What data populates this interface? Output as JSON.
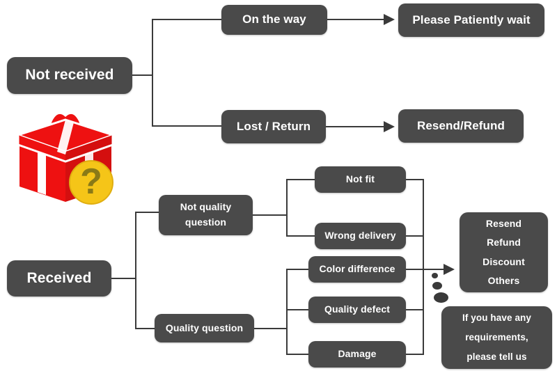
{
  "diagram": {
    "title": "Order issue resolution flowchart",
    "colors": {
      "node_fill": "#4a4a4a",
      "node_text": "#ffffff",
      "connector": "#3a3a3a",
      "background": "#ffffff",
      "gift_red": "#ee1111",
      "gift_badge": "#f5c518",
      "gift_question": "#8a7a17"
    },
    "icons": {
      "gift_box": "gift-box-icon",
      "question_badge": "question-mark-badge-icon",
      "arrow": "arrow-right-icon",
      "dots": "three-dots-icon"
    },
    "nodes": {
      "not_received": "Not received",
      "on_the_way": "On the way",
      "please_wait": "Please Patiently wait",
      "lost_return": "Lost / Return",
      "resend_refund": "Resend/Refund",
      "received": "Received",
      "not_quality_question_line1": "Not quality",
      "not_quality_question_line2": "question",
      "quality_question": "Quality question",
      "not_fit": "Not fit",
      "wrong_delivery": "Wrong delivery",
      "color_difference": "Color difference",
      "quality_defect": "Quality defect",
      "damage": "Damage",
      "outcome_line1": "Resend",
      "outcome_line2": "Refund",
      "outcome_line3": "Discount",
      "outcome_line4": "Others",
      "note_line1": "If you have any",
      "note_line2": "requirements,",
      "note_line3": "please tell us"
    }
  }
}
